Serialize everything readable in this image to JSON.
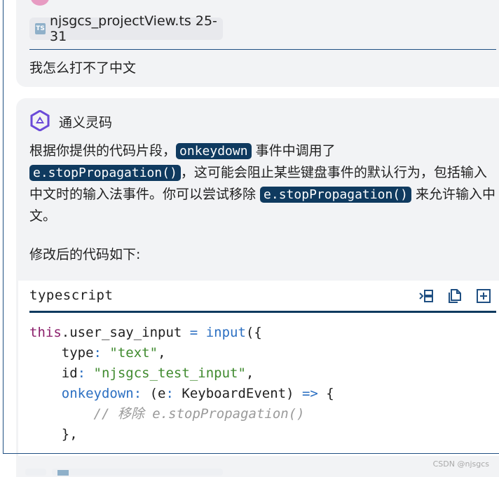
{
  "user_message": {
    "file_chip": {
      "icon": "TS",
      "label": "njsgcs_projectView.ts 25-31"
    },
    "text": "我怎么打不了中文"
  },
  "assistant": {
    "name": "通义灵码",
    "para1": {
      "t1": "根据你提供的代码片段，",
      "c1": "onkeydown",
      "t2": " 事件中调用了",
      "c2": "e.stopPropagation()",
      "t3": "，这可能会阻止某些键盘事件的默认行为，包括输入中文时的输入法事件。你可以尝试移除 ",
      "c3": "e.stopPropagation()",
      "t4": " 来允许输入中文。"
    },
    "para2": "修改后的代码如下:"
  },
  "code_block": {
    "language": "typescript",
    "tools": [
      "insert-icon",
      "copy-icon",
      "new-file-icon"
    ],
    "lines": {
      "l1": {
        "kw": "this",
        "a": ".user_say_input ",
        "op": "=",
        "sp": " ",
        "fn": "input",
        "b": "({"
      },
      "l2": {
        "prop": "    type",
        "colon": ":",
        "sp": " ",
        "str": "\"text\"",
        "end": ","
      },
      "l3": {
        "prop": "    id",
        "colon": ":",
        "sp": " ",
        "str": "\"njsgcs_test_input\"",
        "end": ","
      },
      "l4": {
        "prop": "    onkeydown:",
        "a": " (e",
        "colon": ":",
        "b": " KeyboardEvent) ",
        "op": "=>",
        "c": " {"
      },
      "l5": {
        "cmt": "        // 移除 e.stopPropagation()"
      },
      "l6": {
        "a": "    },"
      }
    }
  },
  "footer": {
    "watermark": "CSDN @njsgcs"
  }
}
